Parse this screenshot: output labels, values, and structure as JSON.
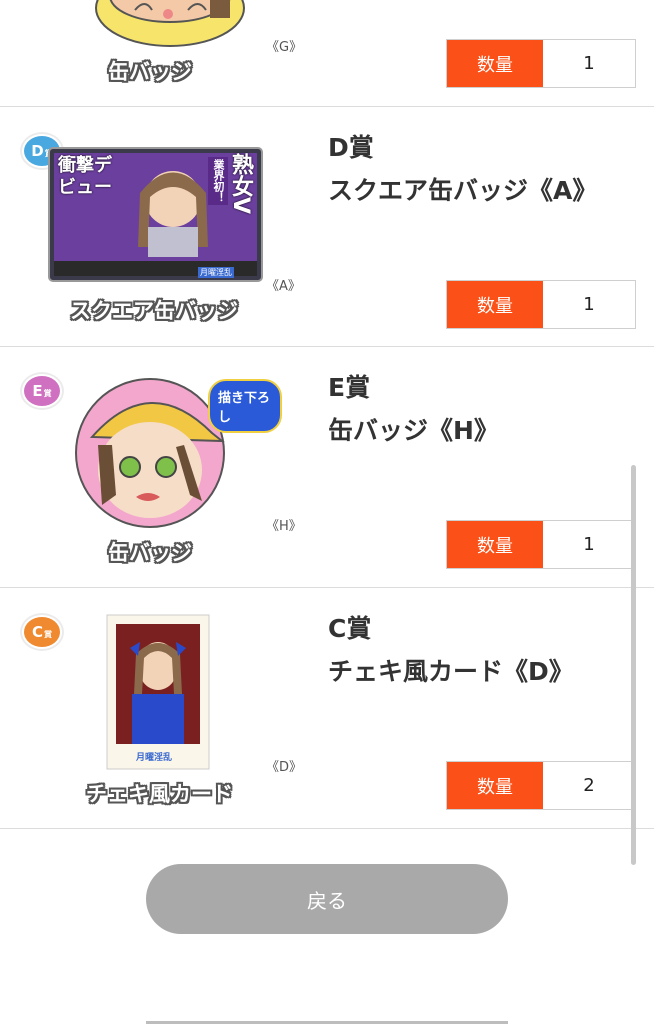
{
  "rows": [
    {
      "variant_tag": "《G》",
      "caption": "缶バッジ",
      "qty_label": "数量",
      "qty_value": "1"
    },
    {
      "badge": "D",
      "badge_small": "賞",
      "prize": "D賞",
      "item_name": "スクエア缶バッジ《A》",
      "variant_tag": "《A》",
      "caption": "スクエア缶バッジ",
      "art_text_1": "業界初！",
      "art_text_2": "熟女V",
      "art_text_3": "衝撃デビュー",
      "art_logo": "月曜淫乱",
      "qty_label": "数量",
      "qty_value": "1"
    },
    {
      "badge": "E",
      "badge_small": "賞",
      "prize": "E賞",
      "item_name": "缶バッジ《H》",
      "variant_tag": "《H》",
      "caption": "缶バッジ",
      "art_bubble": "描き下ろし",
      "qty_label": "数量",
      "qty_value": "1"
    },
    {
      "badge": "C",
      "badge_small": "賞",
      "prize": "C賞",
      "item_name": "チェキ風カード《D》",
      "variant_tag": "《D》",
      "caption": "チェキ風カード",
      "art_logo": "月曜淫乱",
      "qty_label": "数量",
      "qty_value": "2"
    }
  ],
  "back_button": "戻る",
  "colors": {
    "accent": "#fb5017",
    "button_disabled": "#a9a9a9",
    "badge_d": "#4aa8e0",
    "badge_e": "#d070c0",
    "badge_c": "#f08a30"
  }
}
